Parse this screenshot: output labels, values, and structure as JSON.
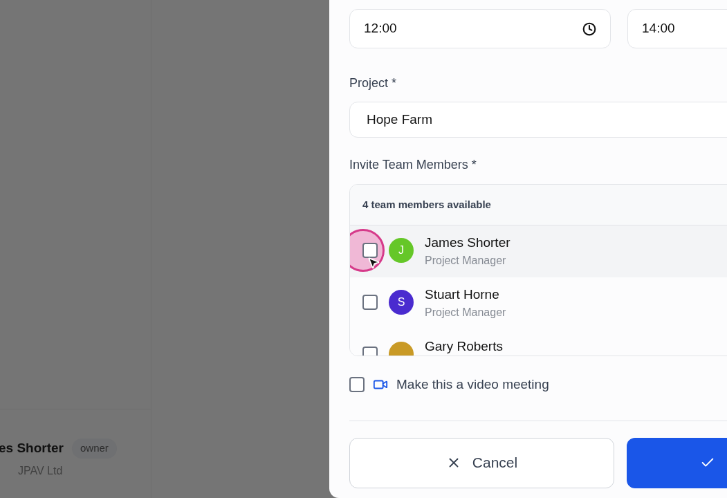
{
  "background": {
    "user_name": "es Shorter",
    "badge": "owner",
    "company": "JPAV Ltd"
  },
  "times": [
    {
      "value": "12:00",
      "clock_icon": true
    },
    {
      "value": "14:00",
      "clock_icon": false
    }
  ],
  "project": {
    "label": "Project *",
    "value": "Hope Farm"
  },
  "invite": {
    "label": "Invite Team Members *",
    "summary": "4 team members available",
    "members": [
      {
        "initial": "J",
        "name": "James Shorter",
        "role": "Project Manager",
        "color": "#65c728",
        "checked": false,
        "highlighted": true,
        "clicked": true
      },
      {
        "initial": "S",
        "name": "Stuart Horne",
        "role": "Project Manager",
        "color": "#4a2bcf",
        "checked": false,
        "highlighted": false,
        "clicked": false
      },
      {
        "name": "Gary Roberts",
        "color": "#c99a26",
        "checked": false,
        "highlighted": false,
        "clicked": false
      }
    ]
  },
  "video": {
    "label": "Make this a video meeting",
    "checked": false
  },
  "buttons": [
    {
      "kind": "secondary",
      "label": "Cancel"
    },
    {
      "kind": "primary"
    }
  ]
}
